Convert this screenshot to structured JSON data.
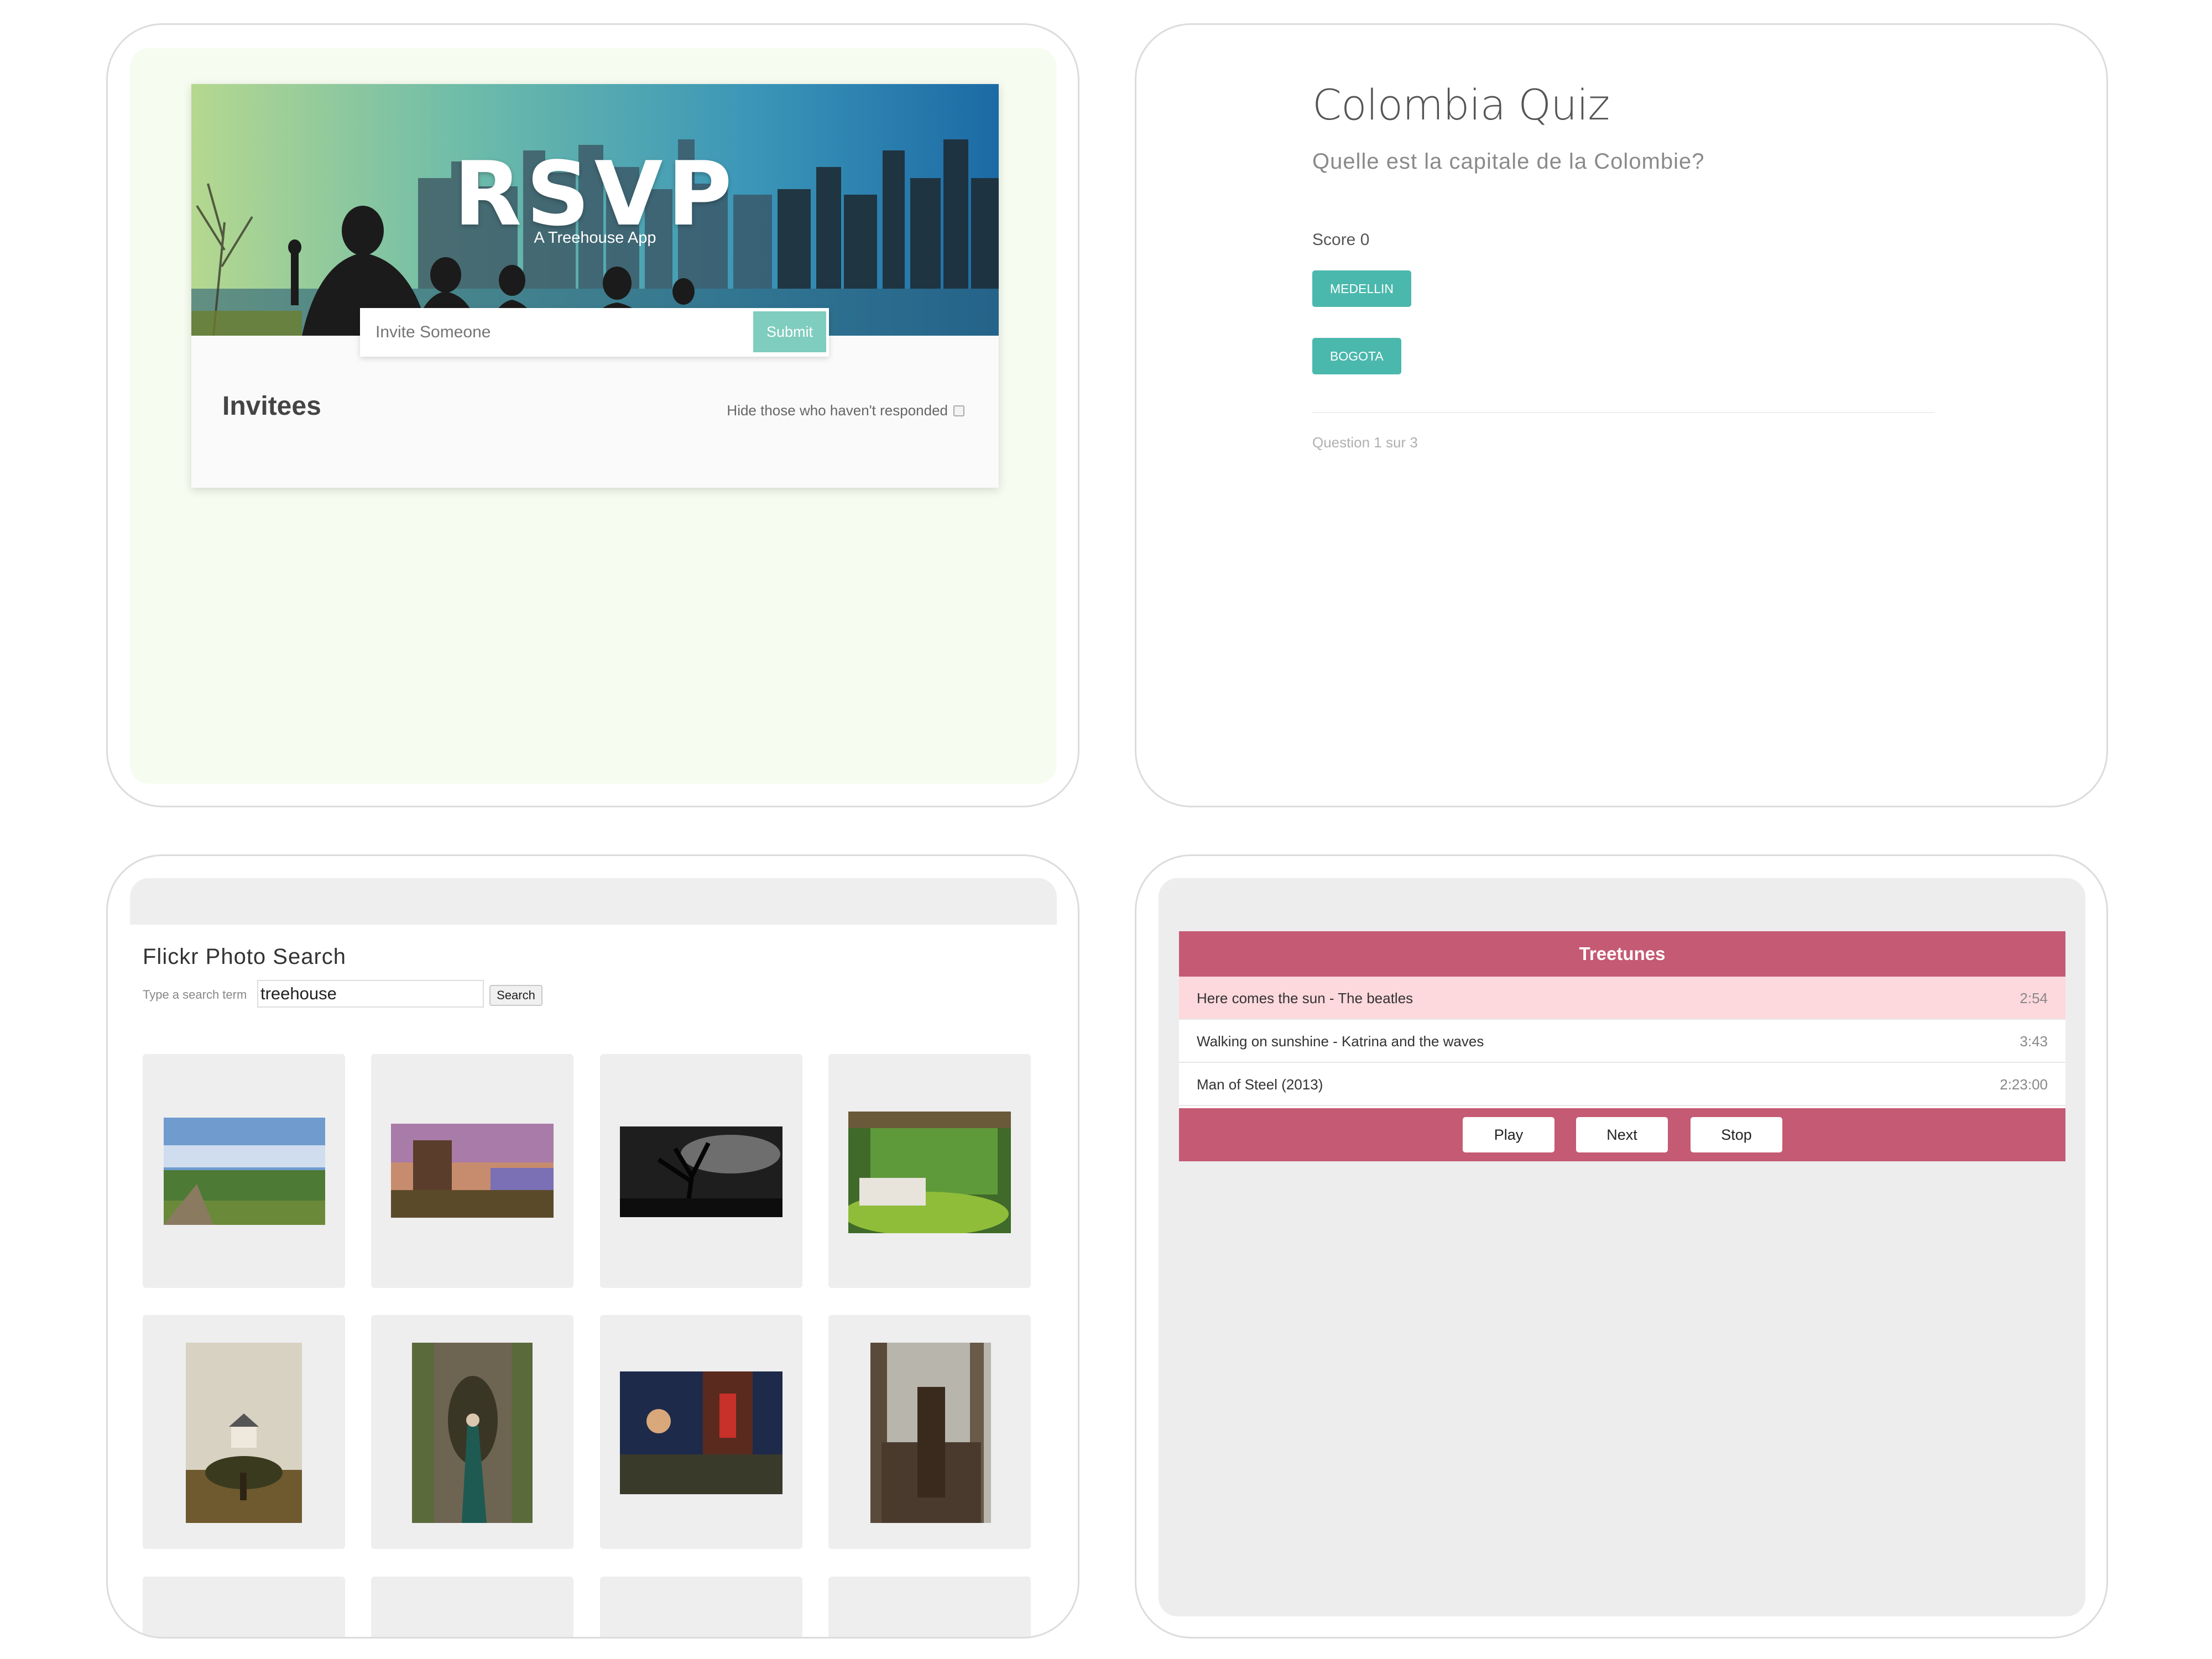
{
  "rsvp": {
    "title": "RSVP",
    "subtitle": "A Treehouse App",
    "invite_placeholder": "Invite Someone",
    "submit_label": "Submit",
    "invitees_heading": "Invitees",
    "hide_label": "Hide those who haven't responded",
    "hide_checked": false,
    "colors": {
      "background": "#f7fcf0",
      "submit": "#7fcdbe"
    }
  },
  "quiz": {
    "title": "Colombia Quiz",
    "question": "Quelle est la capitale de la Colombie?",
    "score": "Score 0",
    "choices": [
      "MEDELLIN",
      "BOGOTA"
    ],
    "progress": "Question 1 sur 3",
    "colors": {
      "button": "#4bb8ad"
    }
  },
  "flickr": {
    "title": "Flickr Photo Search",
    "search_label": "Type a search term",
    "search_value": "treehouse",
    "search_button": "Search",
    "photos": [
      {
        "name": "valley-landscape-photo"
      },
      {
        "name": "castle-sunset-photo"
      },
      {
        "name": "dark-tree-photo"
      },
      {
        "name": "treehouse-bedroom-photo"
      },
      {
        "name": "house-on-tree-photo"
      },
      {
        "name": "person-in-tree-photo"
      },
      {
        "name": "night-forest-scene-photo"
      },
      {
        "name": "wooden-treehouse-photo"
      }
    ]
  },
  "treetunes": {
    "title": "Treetunes",
    "songs": [
      {
        "name": "Here comes the sun - The beatles",
        "duration": "2:54",
        "active": true
      },
      {
        "name": "Walking on sunshine - Katrina and the waves",
        "duration": "3:43",
        "active": false
      },
      {
        "name": "Man of Steel (2013)",
        "duration": "2:23:00",
        "active": false
      }
    ],
    "controls": {
      "play": "Play",
      "next": "Next",
      "stop": "Stop"
    },
    "colors": {
      "accent": "#c45a73",
      "active_row": "#fdd8dc"
    }
  }
}
